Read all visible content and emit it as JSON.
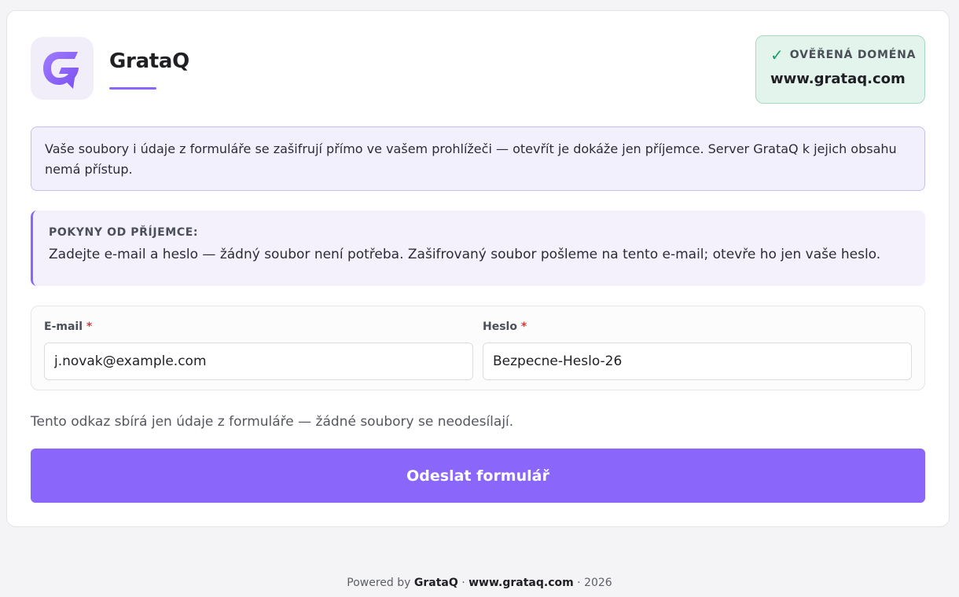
{
  "brand": {
    "name": "GrataQ",
    "logo_icon": "grataq-logo-icon"
  },
  "verified": {
    "label": "OVĚŘENÁ DOMÉNA",
    "domain": "www.grataq.com",
    "icon": "check-icon",
    "color": "#1d9c6a"
  },
  "notice": {
    "text": "Vaše soubory i údaje z formuláře se zašifrují přímo ve vašem prohlížeči — otevřít je dokáže jen příjemce. Server GrataQ k jejich obsahu nemá přístup."
  },
  "instructions": {
    "title": "POKYNY OD PŘÍJEMCE:",
    "text": "Zadejte e-mail a heslo — žádný soubor není potřeba. Zašifrovaný soubor pošleme na tento e-mail; otevře ho jen vaše heslo."
  },
  "form": {
    "email": {
      "label": "E-mail",
      "required_mark": "*",
      "value": "j.novak@example.com"
    },
    "password": {
      "label": "Heslo",
      "required_mark": "*",
      "value": "Bezpecne-Heslo-26"
    }
  },
  "hint": "Tento odkaz sbírá jen údaje z formuláře — žádné soubory se neodesílají.",
  "submit_label": "Odeslat formulář",
  "footer": {
    "prefix": "Powered by",
    "brand": "GrataQ",
    "sep1": "·",
    "domain": "www.grataq.com",
    "sep2": "·",
    "year": "2026"
  },
  "colors": {
    "accent": "#8b66fb",
    "verified_bg": "#e3f4ec",
    "required": "#d23c3c"
  }
}
